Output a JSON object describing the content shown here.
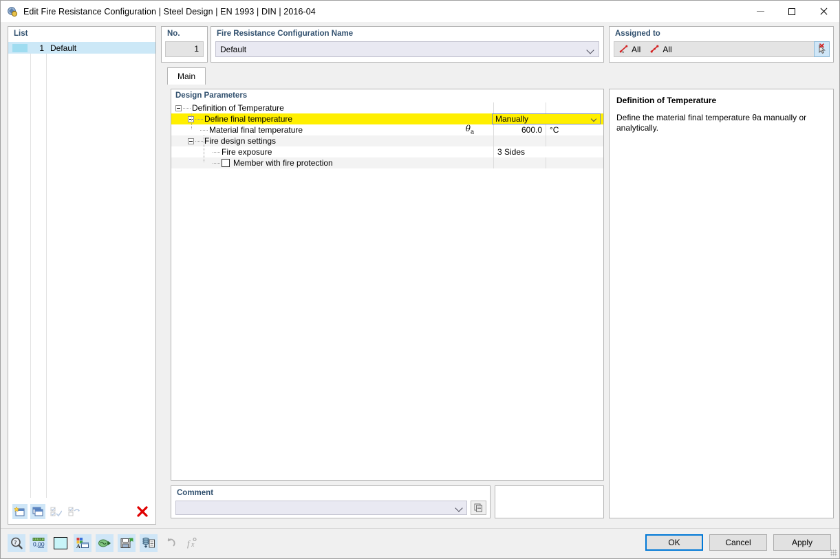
{
  "window": {
    "title": "Edit Fire Resistance Configuration | Steel Design | EN 1993 | DIN | 2016-04",
    "app_icon": "dialog-icon",
    "minimize_label": "Minimize",
    "maximize_label": "Maximize",
    "close_label": "Close"
  },
  "list": {
    "title": "List",
    "rows": [
      {
        "no": "1",
        "name": "Default",
        "selected": true
      }
    ],
    "toolbar": [
      {
        "name": "new-configuration-button",
        "icon": "new-window-icon",
        "enabled": true
      },
      {
        "name": "copy-configuration-button",
        "icon": "copy-window-icon",
        "enabled": true
      },
      {
        "name": "select-all-button",
        "icon": "check-all-icon",
        "enabled": false
      },
      {
        "name": "invert-selection-button",
        "icon": "invert-selection-icon",
        "enabled": false
      },
      {
        "name": "delete-configuration-button",
        "icon": "red-x-icon",
        "enabled": true
      }
    ]
  },
  "no_panel": {
    "title": "No.",
    "value": "1"
  },
  "name_panel": {
    "title": "Fire Resistance Configuration Name",
    "value": "Default",
    "placeholder": "",
    "chevron": "chevron-down-icon"
  },
  "assigned": {
    "title": "Assigned to",
    "items": [
      {
        "icon": "member-icon",
        "label": "All"
      },
      {
        "icon": "line-icon",
        "label": "All"
      }
    ],
    "deselect_button": "deselect-cursor-icon"
  },
  "tabs": [
    {
      "label": "Main",
      "active": true
    }
  ],
  "design_parameters": {
    "title": "Design Parameters",
    "rows": [
      {
        "label": "Definition of Temperature",
        "indent": 0,
        "expander": true,
        "dots": false,
        "checkbox": false,
        "symbol": "",
        "value": "",
        "unit": "",
        "style": "plain",
        "control": "none"
      },
      {
        "label": "Define final temperature",
        "indent": 1,
        "expander": true,
        "dots": true,
        "checkbox": false,
        "symbol": "",
        "value": "Manually",
        "unit": "",
        "style": "highlight",
        "control": "combo"
      },
      {
        "label": "Material final temperature",
        "indent": 2,
        "expander": false,
        "dots": true,
        "checkbox": false,
        "symbol": "θa",
        "value": "600.0",
        "unit": "°C",
        "style": "plain",
        "control": "edit"
      },
      {
        "label": "Fire design settings",
        "indent": 1,
        "expander": true,
        "dots": true,
        "checkbox": false,
        "symbol": "",
        "value": "",
        "unit": "",
        "style": "gray",
        "control": "none"
      },
      {
        "label": "Fire exposure",
        "indent": 2,
        "expander": false,
        "dots": true,
        "checkbox": false,
        "symbol": "",
        "value": "3 Sides",
        "unit": "",
        "style": "plain",
        "control": "text"
      },
      {
        "label": "Member with fire protection",
        "indent": 2,
        "expander": false,
        "dots": true,
        "checkbox": true,
        "checked": false,
        "symbol": "",
        "value": "",
        "unit": "",
        "style": "gray",
        "control": "none"
      }
    ]
  },
  "comment": {
    "title": "Comment",
    "value": "",
    "placeholder": "",
    "chevron": "chevron-down-icon",
    "browse_button": "comment-library-icon"
  },
  "info": {
    "heading": "Definition of Temperature",
    "body": "Define the material final temperature θa manually or analytically."
  },
  "bottom_tools": [
    {
      "name": "help-button",
      "icon": "magnifier-question-icon",
      "enabled": true
    },
    {
      "name": "units-decimals-button",
      "icon": "units-0.00-icon",
      "enabled": true
    },
    {
      "name": "color-button",
      "icon": "color-swatch-icon",
      "enabled": true
    },
    {
      "name": "display-properties-button",
      "icon": "render-properties-icon",
      "enabled": true
    },
    {
      "name": "import-button",
      "icon": "import-arrow-icon",
      "enabled": true
    },
    {
      "name": "save-button",
      "icon": "floppy-disk-icon",
      "enabled": true
    },
    {
      "name": "copy-from-library-button",
      "icon": "stack-document-icon",
      "enabled": true
    },
    {
      "name": "undo-button",
      "icon": "undo-arrow-icon",
      "enabled": false
    },
    {
      "name": "formula-button",
      "icon": "fx-icon",
      "enabled": false
    }
  ],
  "dialog_buttons": [
    {
      "name": "ok-button",
      "label": "OK",
      "primary": true
    },
    {
      "name": "cancel-button",
      "label": "Cancel",
      "primary": false
    },
    {
      "name": "apply-button",
      "label": "Apply",
      "primary": false
    }
  ],
  "colors": {
    "highlight": "#ffef00",
    "selection": "#cce8f7",
    "group_title": "#31506e",
    "accent": "#0078d7",
    "delete_red": "#e00000"
  }
}
